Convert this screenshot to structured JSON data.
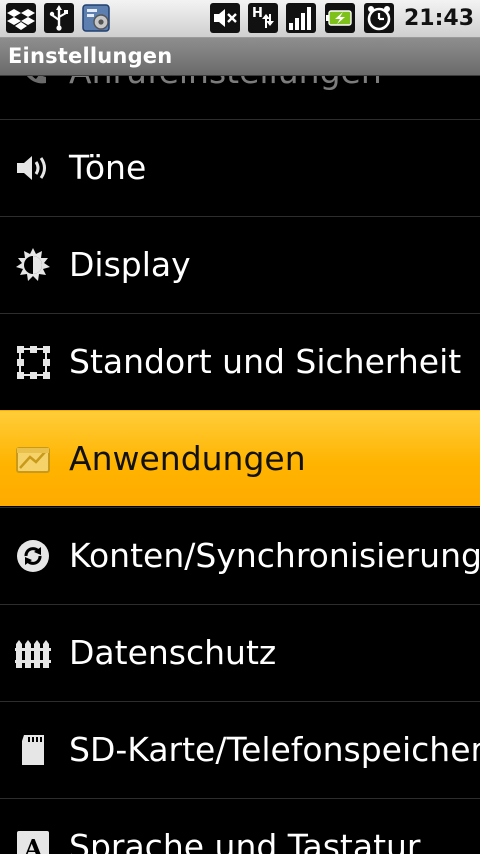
{
  "status_bar": {
    "time": "21:43",
    "network_type_badge": "H",
    "left_icons": [
      "dropbox-icon",
      "usb-icon",
      "settings-notification-icon"
    ],
    "right_icons": [
      "mute-icon",
      "hspa-data-icon",
      "signal-icon",
      "battery-charging-icon",
      "alarm-icon"
    ]
  },
  "title_bar": {
    "title": "Einstellungen"
  },
  "settings": {
    "items": [
      {
        "label": "Anrufeinstellungen",
        "icon": "phone-icon"
      },
      {
        "label": "Töne",
        "icon": "speaker-icon"
      },
      {
        "label": "Display",
        "icon": "brightness-icon"
      },
      {
        "label": "Standort und Sicherheit",
        "icon": "location-grid-icon"
      },
      {
        "label": "Anwendungen",
        "icon": "applications-icon",
        "selected": true
      },
      {
        "label": "Konten/Synchronisierung",
        "icon": "sync-icon"
      },
      {
        "label": "Datenschutz",
        "icon": "privacy-fence-icon"
      },
      {
        "label": "SD-Karte/Telefonspeicher",
        "icon": "sd-card-icon"
      },
      {
        "label": "Sprache und Tastatur",
        "icon": "keyboard-letter-icon"
      }
    ]
  },
  "colors": {
    "selection": "#ffb400",
    "statusbar": "#e0e0e0",
    "titlebar": "#7d7d7d",
    "background": "#000000"
  }
}
